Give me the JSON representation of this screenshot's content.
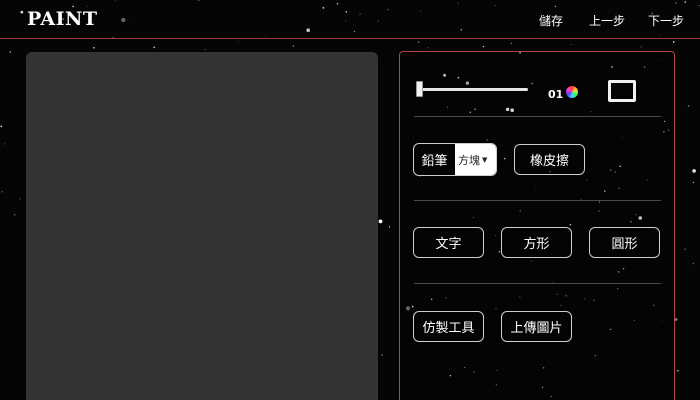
{
  "app": {
    "logo": "PAINT",
    "nav": {
      "save": "儲存",
      "undo": "上一步",
      "redo": "下一步"
    }
  },
  "toolbar": {
    "brush_size": "01",
    "brush_size_percent": 0,
    "pencil_label": "鉛筆",
    "brush_shape_selected": "方塊",
    "eraser_label": "橡皮擦",
    "text_label": "文字",
    "rect_label": "方形",
    "circle_label": "圓形",
    "clone_label": "仿製工具",
    "upload_label": "上傳圖片"
  },
  "colors": {
    "background": "#050505",
    "canvas": "#333333",
    "panel_border": "#b04545",
    "accent_line": "#9e3b3b"
  },
  "icons": [
    "color-wheel-icon",
    "rectangle-shape-icon",
    "dropdown-arrow-icon"
  ]
}
